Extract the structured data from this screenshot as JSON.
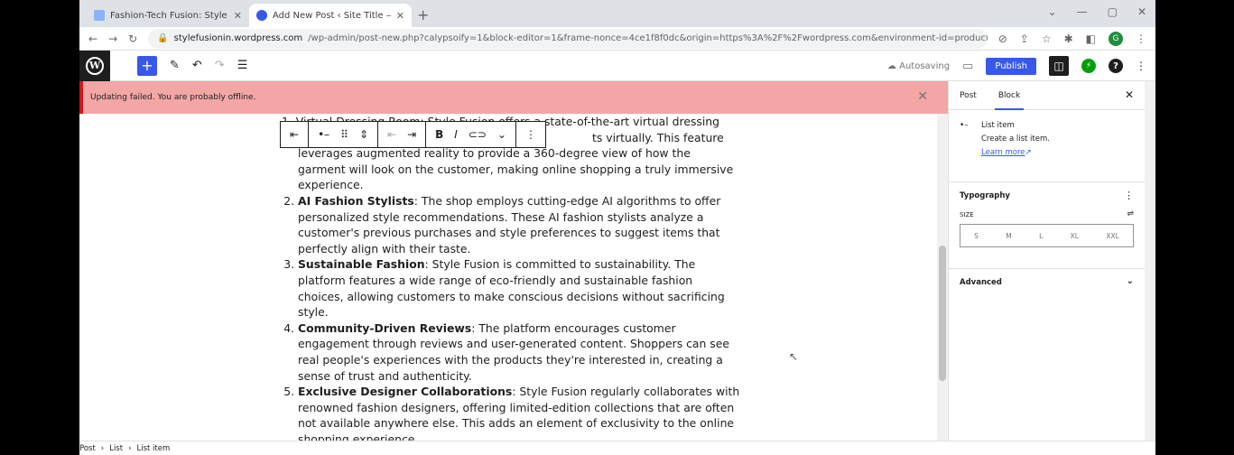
{
  "browser": {
    "tabs": [
      {
        "title": "Fashion-Tech Fusion: Style Revol",
        "active": false
      },
      {
        "title": "Add New Post ‹ Site Title — Wo",
        "active": true
      }
    ],
    "url_main": "stylefusionin.wordpress.com",
    "url_rest": "/wp-admin/post-new.php?calypsoify=1&block-editor=1&frame-nonce=4ce1f8f0dc&origin=https%3A%2F%2Fwordpress.com&environment-id=production...",
    "profile_initial": "G"
  },
  "wp_header": {
    "status": "Autosaving",
    "publish_label": "Publish"
  },
  "notice": {
    "text": "Updating failed. You are probably offline."
  },
  "content": {
    "intro_line1_pre": "Virtual Dressing Room: Style Fusion offers a state-of-the-art virtual dressing",
    "intro_line2_tail": "ts virtually. This feature",
    "intro_rest": "leverages augmented reality to provide a 360-degree view of how the garment will look on the customer, making online shopping a truly immersive experience.",
    "items": [
      {
        "title": "AI Fashion Stylists",
        "body": ": The shop employs cutting-edge AI algorithms to offer personalized style recommendations. These AI fashion stylists analyze a customer's previous purchases and style preferences to suggest items that perfectly align with their taste."
      },
      {
        "title": "Sustainable Fashion",
        "body": ": Style Fusion is committed to sustainability. The platform features a wide range of eco-friendly and sustainable fashion choices, allowing customers to make conscious decisions without sacrificing style."
      },
      {
        "title": "Community-Driven Reviews",
        "body": ": The platform encourages customer engagement through reviews and user-generated content. Shoppers can see real people's experiences with the products they're interested in, creating a sense of trust and authenticity."
      },
      {
        "title": "Exclusive Designer Collaborations",
        "body": ": Style Fusion regularly collaborates with renowned fashion designers, offering limited-edition collections that are often not available anywhere else. This adds an element of exclusivity to the online shopping experience."
      }
    ]
  },
  "sidebar": {
    "tab_post": "Post",
    "tab_block": "Block",
    "block_name": "List item",
    "block_desc": "Create a list item.",
    "learn_more": "Learn more",
    "typography_title": "Typography",
    "size_label": "SIZE",
    "sizes": [
      "S",
      "M",
      "L",
      "XL",
      "XXL"
    ],
    "advanced": "Advanced"
  },
  "breadcrumb": [
    "Post",
    "List",
    "List item"
  ]
}
